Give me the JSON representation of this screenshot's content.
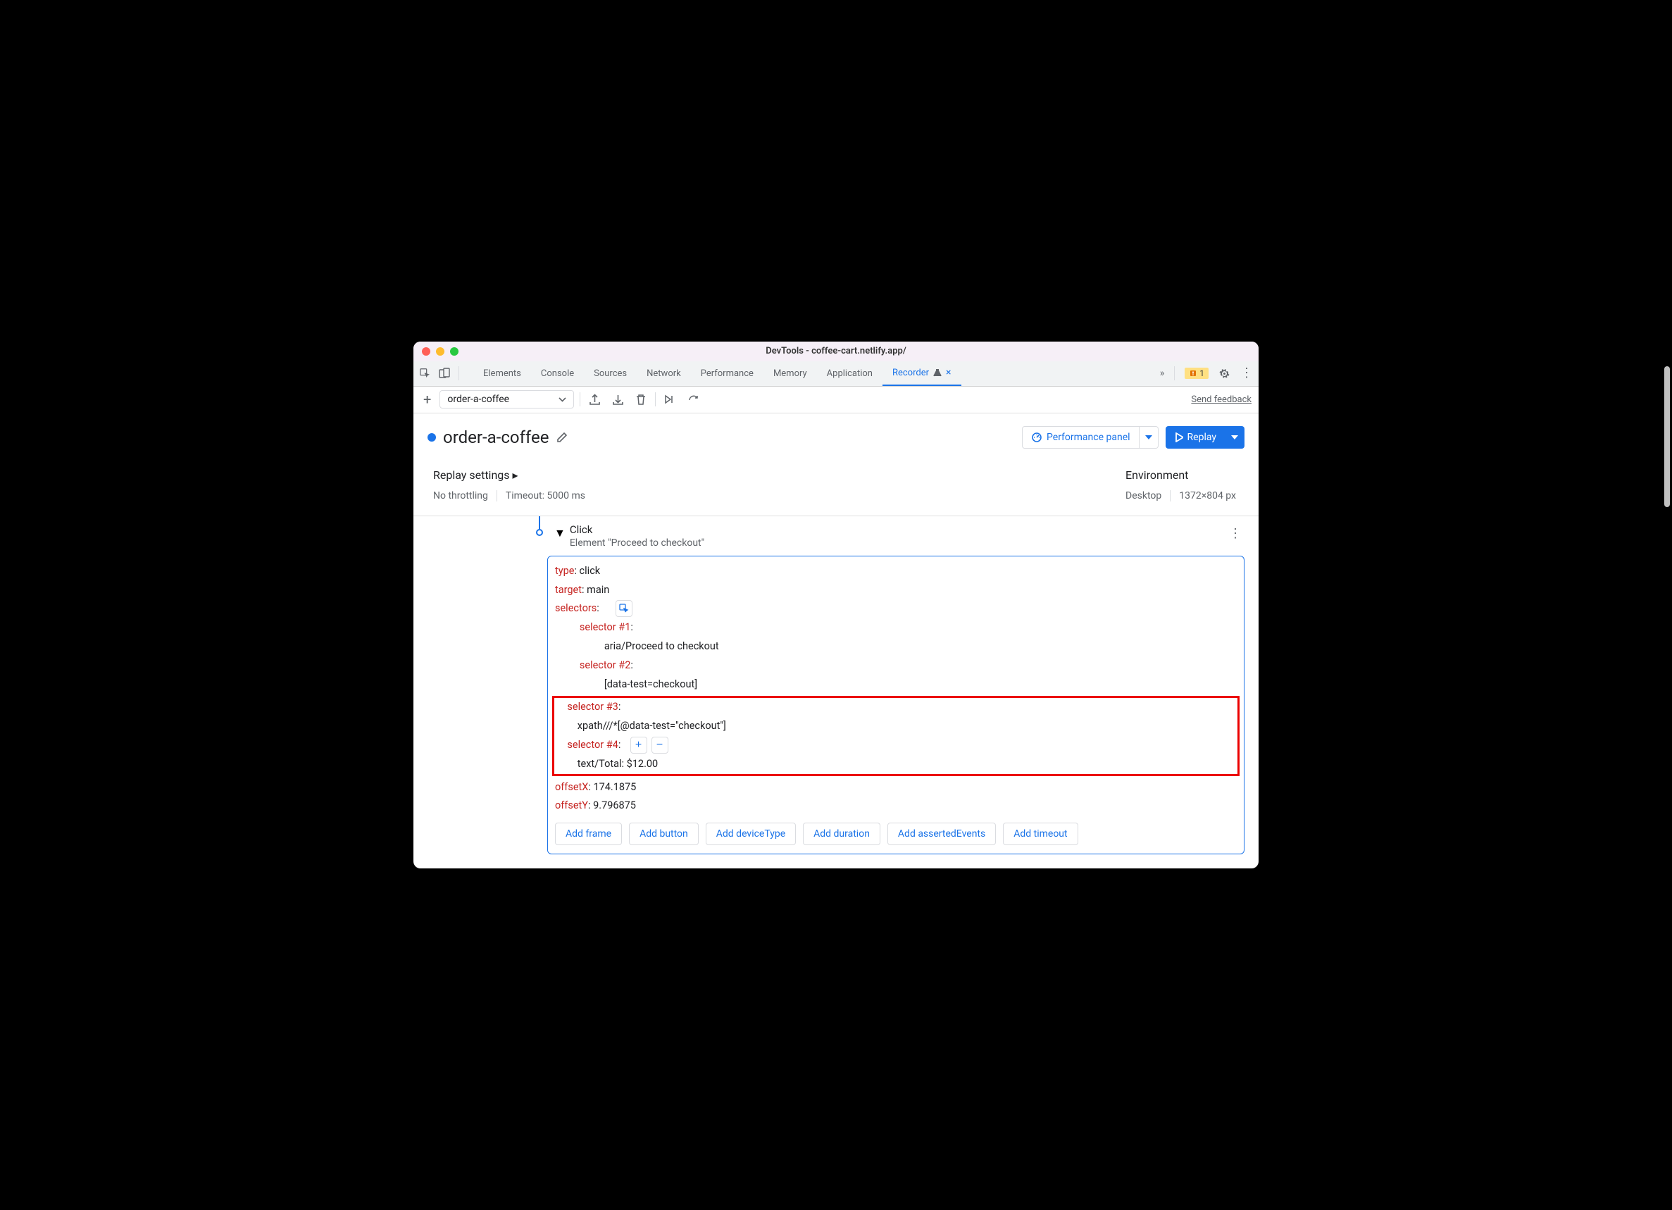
{
  "window": {
    "title": "DevTools - coffee-cart.netlify.app/"
  },
  "tabs": {
    "items": [
      "Elements",
      "Console",
      "Sources",
      "Network",
      "Performance",
      "Memory",
      "Application",
      "Recorder"
    ],
    "warnCount": "1"
  },
  "toolbar": {
    "recordingName": "order-a-coffee",
    "feedback": "Send feedback"
  },
  "header": {
    "title": "order-a-coffee",
    "perfPanel": "Performance panel",
    "replay": "Replay"
  },
  "settings": {
    "replayLabel": "Replay settings",
    "throttling": "No throttling",
    "timeout": "Timeout: 5000 ms",
    "envLabel": "Environment",
    "envDevice": "Desktop",
    "envSize": "1372×804 px"
  },
  "step": {
    "title": "Click",
    "subtitle": "Element \"Proceed to checkout\"",
    "code": {
      "typeKey": "type",
      "typeVal": ": click",
      "targetKey": "target",
      "targetVal": ": main",
      "selectorsKey": "selectors",
      "selectorsVal": ":",
      "sel1Key": "selector #1",
      "sel1KeyVal": ":",
      "sel1Val": "aria/Proceed to checkout",
      "sel2Key": "selector #2",
      "sel2KeyVal": ":",
      "sel2Val": "[data-test=checkout]",
      "sel3Key": "selector #3",
      "sel3KeyVal": ":",
      "sel3Val": "xpath///*[@data-test=\"checkout\"]",
      "sel4Key": "selector #4",
      "sel4KeyVal": ":",
      "sel4Val": "text/Total: $12.00",
      "offXKey": "offsetX",
      "offXVal": ": 174.1875",
      "offYKey": "offsetY",
      "offYVal": ": 9.796875"
    },
    "addButtons": [
      "Add frame",
      "Add button",
      "Add deviceType",
      "Add duration",
      "Add assertedEvents",
      "Add timeout"
    ]
  }
}
